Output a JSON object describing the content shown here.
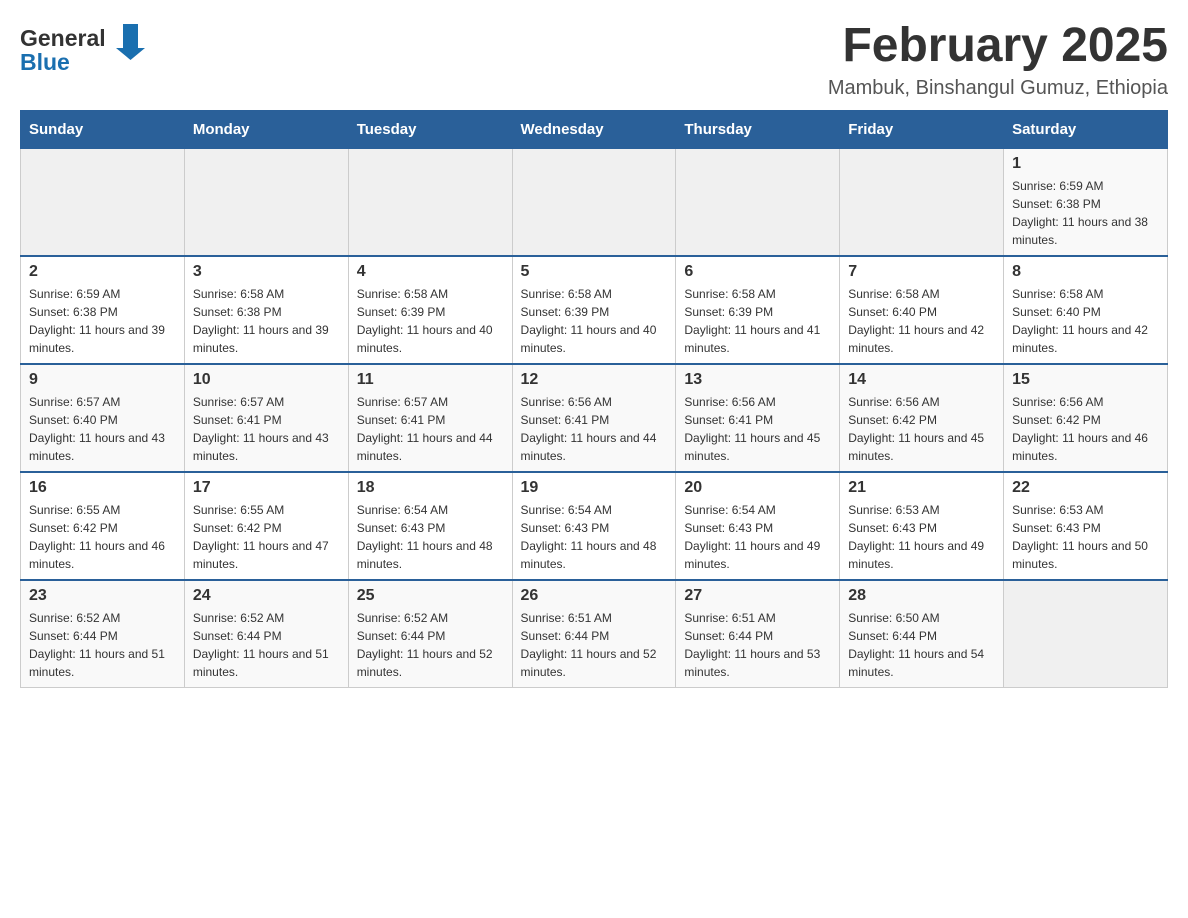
{
  "header": {
    "logo_general": "General",
    "logo_blue": "Blue",
    "month_title": "February 2025",
    "location": "Mambuk, Binshangul Gumuz, Ethiopia"
  },
  "days_of_week": [
    "Sunday",
    "Monday",
    "Tuesday",
    "Wednesday",
    "Thursday",
    "Friday",
    "Saturday"
  ],
  "weeks": [
    {
      "days": [
        {
          "number": "",
          "info": ""
        },
        {
          "number": "",
          "info": ""
        },
        {
          "number": "",
          "info": ""
        },
        {
          "number": "",
          "info": ""
        },
        {
          "number": "",
          "info": ""
        },
        {
          "number": "",
          "info": ""
        },
        {
          "number": "1",
          "info": "Sunrise: 6:59 AM\nSunset: 6:38 PM\nDaylight: 11 hours and 38 minutes."
        }
      ]
    },
    {
      "days": [
        {
          "number": "2",
          "info": "Sunrise: 6:59 AM\nSunset: 6:38 PM\nDaylight: 11 hours and 39 minutes."
        },
        {
          "number": "3",
          "info": "Sunrise: 6:58 AM\nSunset: 6:38 PM\nDaylight: 11 hours and 39 minutes."
        },
        {
          "number": "4",
          "info": "Sunrise: 6:58 AM\nSunset: 6:39 PM\nDaylight: 11 hours and 40 minutes."
        },
        {
          "number": "5",
          "info": "Sunrise: 6:58 AM\nSunset: 6:39 PM\nDaylight: 11 hours and 40 minutes."
        },
        {
          "number": "6",
          "info": "Sunrise: 6:58 AM\nSunset: 6:39 PM\nDaylight: 11 hours and 41 minutes."
        },
        {
          "number": "7",
          "info": "Sunrise: 6:58 AM\nSunset: 6:40 PM\nDaylight: 11 hours and 42 minutes."
        },
        {
          "number": "8",
          "info": "Sunrise: 6:58 AM\nSunset: 6:40 PM\nDaylight: 11 hours and 42 minutes."
        }
      ]
    },
    {
      "days": [
        {
          "number": "9",
          "info": "Sunrise: 6:57 AM\nSunset: 6:40 PM\nDaylight: 11 hours and 43 minutes."
        },
        {
          "number": "10",
          "info": "Sunrise: 6:57 AM\nSunset: 6:41 PM\nDaylight: 11 hours and 43 minutes."
        },
        {
          "number": "11",
          "info": "Sunrise: 6:57 AM\nSunset: 6:41 PM\nDaylight: 11 hours and 44 minutes."
        },
        {
          "number": "12",
          "info": "Sunrise: 6:56 AM\nSunset: 6:41 PM\nDaylight: 11 hours and 44 minutes."
        },
        {
          "number": "13",
          "info": "Sunrise: 6:56 AM\nSunset: 6:41 PM\nDaylight: 11 hours and 45 minutes."
        },
        {
          "number": "14",
          "info": "Sunrise: 6:56 AM\nSunset: 6:42 PM\nDaylight: 11 hours and 45 minutes."
        },
        {
          "number": "15",
          "info": "Sunrise: 6:56 AM\nSunset: 6:42 PM\nDaylight: 11 hours and 46 minutes."
        }
      ]
    },
    {
      "days": [
        {
          "number": "16",
          "info": "Sunrise: 6:55 AM\nSunset: 6:42 PM\nDaylight: 11 hours and 46 minutes."
        },
        {
          "number": "17",
          "info": "Sunrise: 6:55 AM\nSunset: 6:42 PM\nDaylight: 11 hours and 47 minutes."
        },
        {
          "number": "18",
          "info": "Sunrise: 6:54 AM\nSunset: 6:43 PM\nDaylight: 11 hours and 48 minutes."
        },
        {
          "number": "19",
          "info": "Sunrise: 6:54 AM\nSunset: 6:43 PM\nDaylight: 11 hours and 48 minutes."
        },
        {
          "number": "20",
          "info": "Sunrise: 6:54 AM\nSunset: 6:43 PM\nDaylight: 11 hours and 49 minutes."
        },
        {
          "number": "21",
          "info": "Sunrise: 6:53 AM\nSunset: 6:43 PM\nDaylight: 11 hours and 49 minutes."
        },
        {
          "number": "22",
          "info": "Sunrise: 6:53 AM\nSunset: 6:43 PM\nDaylight: 11 hours and 50 minutes."
        }
      ]
    },
    {
      "days": [
        {
          "number": "23",
          "info": "Sunrise: 6:52 AM\nSunset: 6:44 PM\nDaylight: 11 hours and 51 minutes."
        },
        {
          "number": "24",
          "info": "Sunrise: 6:52 AM\nSunset: 6:44 PM\nDaylight: 11 hours and 51 minutes."
        },
        {
          "number": "25",
          "info": "Sunrise: 6:52 AM\nSunset: 6:44 PM\nDaylight: 11 hours and 52 minutes."
        },
        {
          "number": "26",
          "info": "Sunrise: 6:51 AM\nSunset: 6:44 PM\nDaylight: 11 hours and 52 minutes."
        },
        {
          "number": "27",
          "info": "Sunrise: 6:51 AM\nSunset: 6:44 PM\nDaylight: 11 hours and 53 minutes."
        },
        {
          "number": "28",
          "info": "Sunrise: 6:50 AM\nSunset: 6:44 PM\nDaylight: 11 hours and 54 minutes."
        },
        {
          "number": "",
          "info": ""
        }
      ]
    }
  ]
}
